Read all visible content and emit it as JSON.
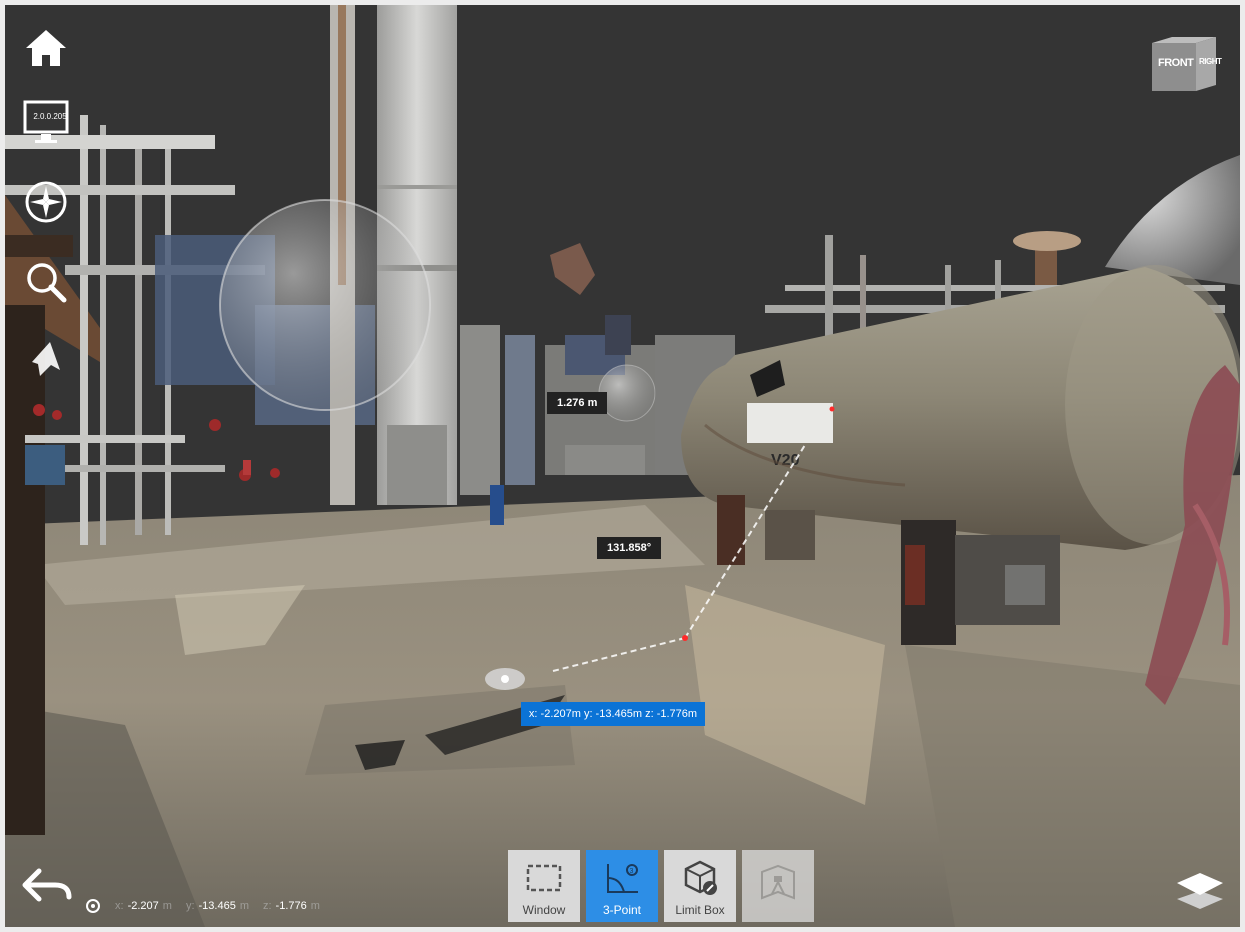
{
  "app": {
    "version": "2.0.0.205"
  },
  "viewcube": {
    "front_label": "FRONT",
    "right_label": "RIGHT"
  },
  "sidebar": {
    "items": [
      {
        "name": "home",
        "icon": "home-icon"
      },
      {
        "name": "version-display",
        "icon": "monitor-icon"
      },
      {
        "name": "navigation",
        "icon": "compass-icon"
      },
      {
        "name": "zoom",
        "icon": "magnifier-icon"
      },
      {
        "name": "walk",
        "icon": "walk-cursor-icon"
      }
    ]
  },
  "measurement": {
    "distance_label": "1.276 m",
    "angle_label": "131.858°",
    "coord_tip": "x: -2.207m y: -13.465m z: -1.776m"
  },
  "toolbar": {
    "tools": [
      {
        "label": "Window",
        "icon": "window-select-icon",
        "active": false
      },
      {
        "label": "3-Point",
        "icon": "three-point-angle-icon",
        "active": true
      },
      {
        "label": "Limit Box",
        "icon": "limit-box-icon",
        "active": false
      },
      {
        "label": "",
        "icon": "scan-station-icon",
        "active": false,
        "disabled": true
      }
    ]
  },
  "status": {
    "x_key": "x:",
    "x_value": "-2.207",
    "x_unit": "m",
    "y_key": "y:",
    "y_value": "-13.465",
    "y_unit": "m",
    "z_key": "z:",
    "z_value": "-1.776",
    "z_unit": "m"
  },
  "colors": {
    "accent": "#2d8ee6",
    "tip_blue": "#0b73d6",
    "background": "#343434"
  }
}
